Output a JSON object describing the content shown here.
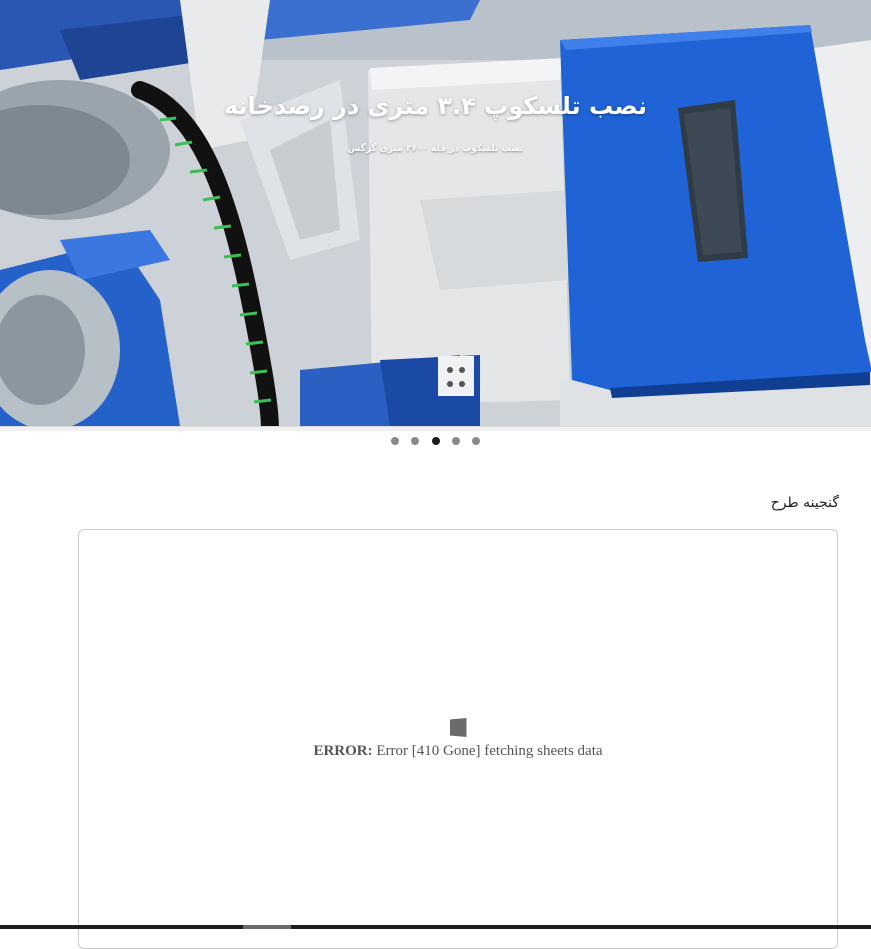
{
  "hero": {
    "title": "نصب تلسکوپ ۳.۴ متری در رصدخانه",
    "subtitle": "نصب تلسکوپ در قله ۳۶۰۰ متری گرگش",
    "slide_count": 5,
    "active_slide": 3
  },
  "gallery": {
    "title": "گنجینه طرح",
    "error_label": "ERROR:",
    "error_message": "Error [410 Gone] fetching sheets data"
  },
  "colors": {
    "machine_blue": "#1f63d6",
    "panel_gray": "#e4e6e8",
    "dot_inactive": "#8a8a8a",
    "dot_active": "#1b1b1b"
  }
}
